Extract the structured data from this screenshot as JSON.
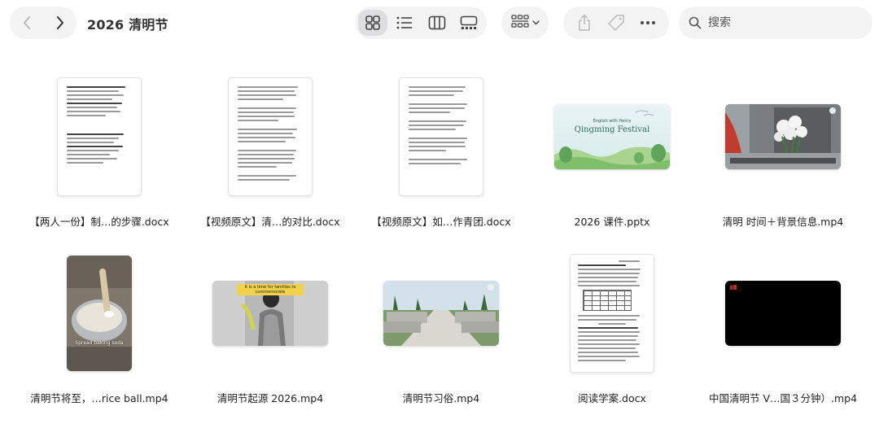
{
  "window": {
    "title": "2026 清明节"
  },
  "toolbar": {
    "nav": [
      "back-icon",
      "forward-icon"
    ],
    "views": [
      {
        "name": "icon-view",
        "icon": "grid-icon",
        "active": true
      },
      {
        "name": "list-view",
        "icon": "list-icon",
        "active": false
      },
      {
        "name": "column-view",
        "icon": "columns-icon",
        "active": false
      },
      {
        "name": "gallery-view",
        "icon": "gallery-icon",
        "active": false
      }
    ],
    "group": {
      "icon": "group-grid-icon",
      "dropdown": "chevron-down-icon"
    },
    "actions": [
      "share-icon",
      "tag-icon",
      "more-icon"
    ],
    "search": {
      "placeholder": "搜索",
      "value": ""
    }
  },
  "files": [
    {
      "name": "【两人一份】制…的步骤.docx",
      "kind": "docx"
    },
    {
      "name": "【视频原文】清…的对比.docx",
      "kind": "docx"
    },
    {
      "name": "【视频原文】如…作青团.docx",
      "kind": "docx"
    },
    {
      "name": "2026 课件.pptx",
      "kind": "pptx",
      "slide": {
        "kicker": "English with Henry",
        "title": "Qingming Festival"
      }
    },
    {
      "name": "清明 时间＋背景信息.mp4",
      "kind": "mp4"
    },
    {
      "name": "清明节将至，…rice ball.mp4",
      "kind": "mp4",
      "caption": "Spread baking soda"
    },
    {
      "name": "清明节起源 2026.mp4",
      "kind": "mp4",
      "caption": "It is a time for families to commemorate"
    },
    {
      "name": "清明节习俗.mp4",
      "kind": "mp4"
    },
    {
      "name": "阅读学案.docx",
      "kind": "docx"
    },
    {
      "name": "中国清明节 V…国３分钟）.mp4",
      "kind": "mp4"
    }
  ],
  "colors": {
    "pill": "#f3f3f4",
    "active": "#dedee0",
    "icon": "#4a4a4a"
  }
}
